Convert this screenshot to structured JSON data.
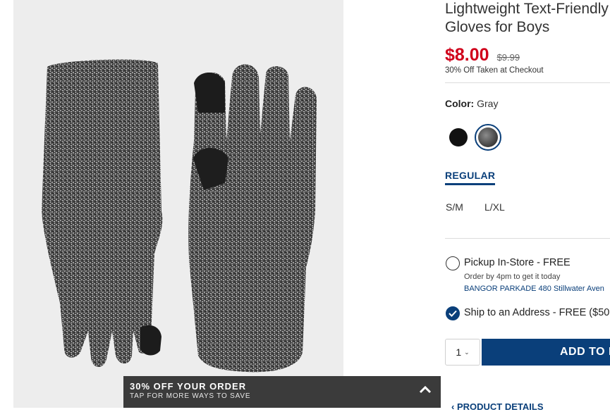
{
  "product": {
    "title_line1": "Lightweight Text-Friendly",
    "title_line2": "Gloves for Boys",
    "price_now": "$8.00",
    "price_was": "$9.99",
    "discount_note": "30% Off Taken at Checkout"
  },
  "color": {
    "label": "Color:",
    "value": "Gray",
    "swatches": [
      {
        "name": "black",
        "selected": false,
        "hex": "#111111"
      },
      {
        "name": "gray",
        "selected": true,
        "hex": "#5a5a5a"
      }
    ],
    "selected_ring_color": "#0a3f7a"
  },
  "fit": {
    "tab_label": "REGULAR",
    "sizes": [
      "S/M",
      "L/XL"
    ]
  },
  "fulfillment": {
    "pickup_label": "Pickup In-Store - FREE",
    "pickup_note": "Order by 4pm to get it today",
    "pickup_store": "BANGOR PARKADE 480 Stillwater Aven",
    "ship_label": "Ship to an Address - FREE ($50"
  },
  "cart": {
    "quantity": "1",
    "add_button": "ADD TO B"
  },
  "details_link": "PRODUCT DETAILS",
  "promo": {
    "headline": "30% OFF YOUR ORDER",
    "sub": "TAP FOR MORE WAYS TO SAVE"
  },
  "colors": {
    "brand_blue": "#0a3f7a",
    "sale_red": "#d0021b",
    "promo_bg": "#3b3b3b"
  }
}
